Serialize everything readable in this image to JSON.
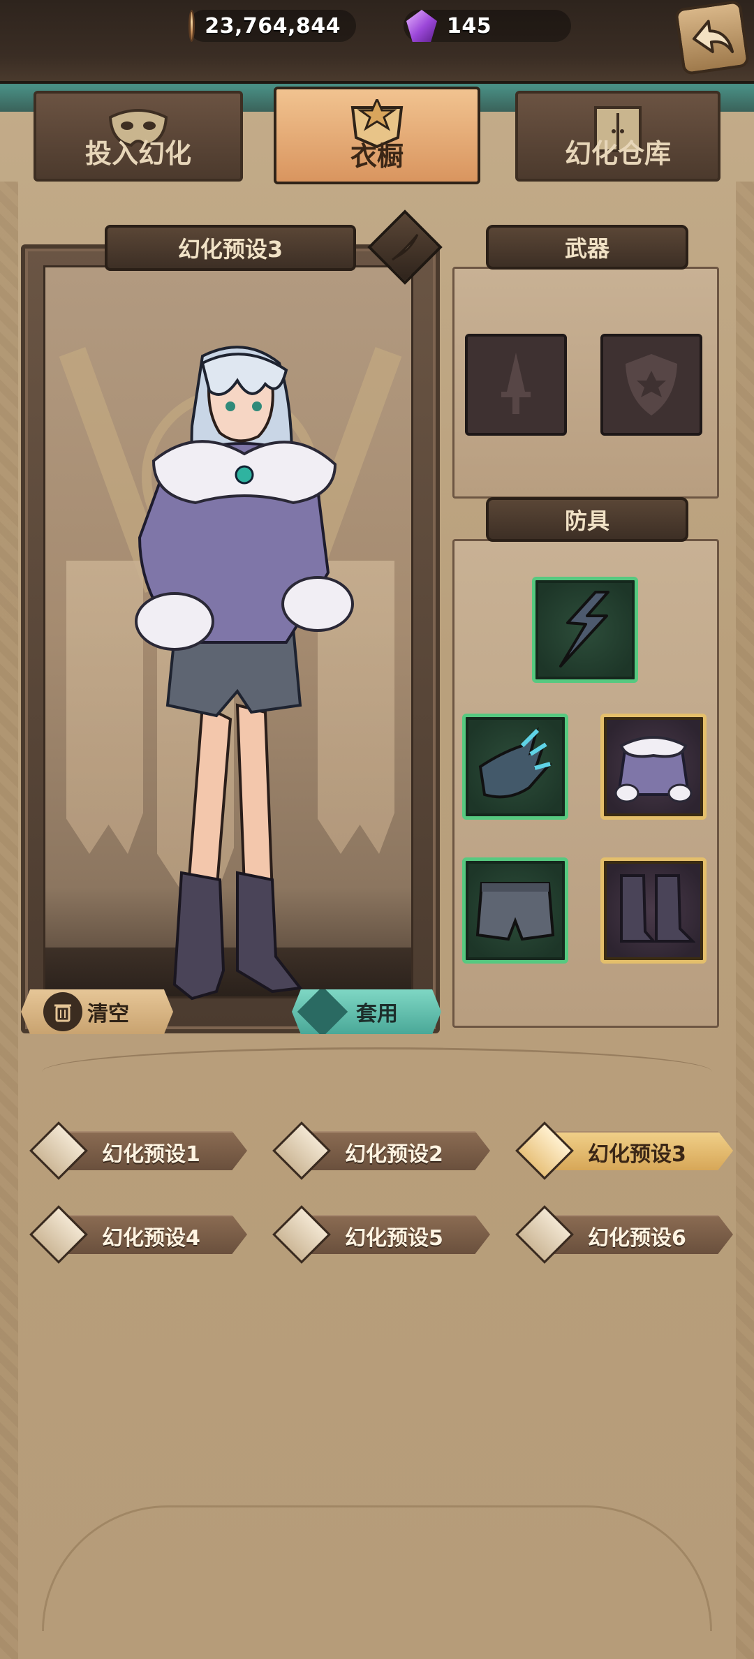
{
  "currency": {
    "coins": "23,764,844",
    "gems": "145"
  },
  "tabs": [
    {
      "label": "投入幻化",
      "icon": "mask-icon"
    },
    {
      "label": "衣橱",
      "icon": "wardrobe-crest-icon",
      "active": true
    },
    {
      "label": "幻化仓库",
      "icon": "warehouse-cabinet-icon"
    }
  ],
  "preset_panel": {
    "title": "幻化预设3",
    "clear_label": "清空",
    "apply_label": "套用"
  },
  "weapon_section": {
    "title": "武器",
    "slots": [
      "sword-slot-icon",
      "shield-slot-icon"
    ]
  },
  "armor_section": {
    "title": "防具",
    "slots": [
      "helmet-shard-icon",
      "gauntlet-icon",
      "fur-coat-icon",
      "shorts-icon",
      "boots-icon"
    ]
  },
  "presets": [
    {
      "label": "幻化预设1"
    },
    {
      "label": "幻化预设2"
    },
    {
      "label": "幻化预设3",
      "active": true
    },
    {
      "label": "幻化预设4"
    },
    {
      "label": "幻化预设5"
    },
    {
      "label": "幻化预设6"
    }
  ],
  "colors": {
    "accent_gold": "#d7a758",
    "apply_teal": "#4aa898",
    "rare_green": "#56c980",
    "epic_gold": "#e4bf6b"
  }
}
